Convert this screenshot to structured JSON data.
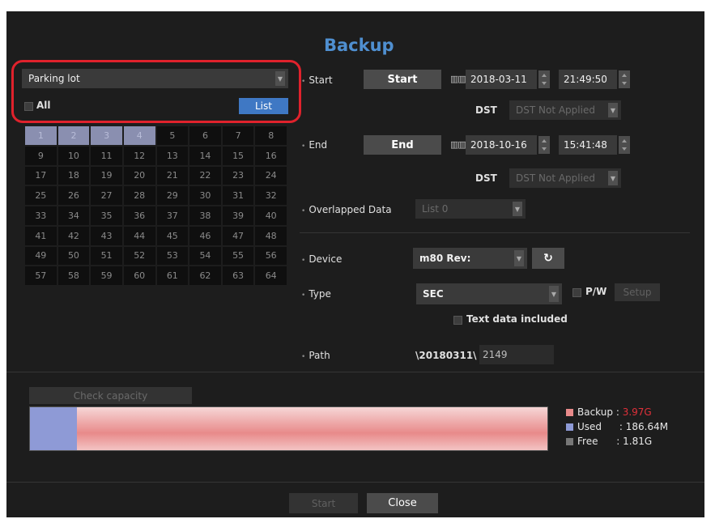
{
  "dialog": {
    "title": "Backup"
  },
  "camera": {
    "selected": "Parking lot",
    "all_label": "All",
    "list_label": "List",
    "channels": [
      "1",
      "2",
      "3",
      "4",
      "5",
      "6",
      "7",
      "8",
      "9",
      "10",
      "11",
      "12",
      "13",
      "14",
      "15",
      "16",
      "17",
      "18",
      "19",
      "20",
      "21",
      "22",
      "23",
      "24",
      "25",
      "26",
      "27",
      "28",
      "29",
      "30",
      "31",
      "32",
      "33",
      "34",
      "35",
      "36",
      "37",
      "38",
      "39",
      "40",
      "41",
      "42",
      "43",
      "44",
      "45",
      "46",
      "47",
      "48",
      "49",
      "50",
      "51",
      "52",
      "53",
      "54",
      "55",
      "56",
      "57",
      "58",
      "59",
      "60",
      "61",
      "62",
      "63",
      "64"
    ],
    "selected_channels": [
      "1",
      "2",
      "3",
      "4"
    ]
  },
  "start": {
    "label": "Start",
    "button": "Start",
    "date": "2018-03-11",
    "time": "21:49:50",
    "dst_label": "DST",
    "dst_value": "DST Not Applied"
  },
  "end": {
    "label": "End",
    "button": "End",
    "date": "2018-10-16",
    "time": "15:41:48",
    "dst_label": "DST",
    "dst_value": "DST Not Applied"
  },
  "overlap": {
    "label": "Overlapped Data",
    "value": "List 0"
  },
  "device": {
    "label": "Device",
    "value": "m80 Rev:"
  },
  "type": {
    "label": "Type",
    "value": "SEC",
    "pw_label": "P/W",
    "setup_label": "Setup",
    "text_data_label": "Text data included"
  },
  "path": {
    "label": "Path",
    "prefix": "\\20180311\\",
    "value": "2149"
  },
  "capacity": {
    "check_label": "Check capacity",
    "backup_label": "Backup",
    "backup_value": "3.97G",
    "used_label": "Used",
    "used_value": "186.64M",
    "free_label": "Free",
    "free_value": "1.81G",
    "used_fraction": 0.09,
    "backup_fraction": 0.91,
    "colors": {
      "backup": "#e88a8a",
      "used": "#8e9ad6",
      "free": "#777777",
      "backup_value": "#e0303a"
    }
  },
  "footer": {
    "start_label": "Start",
    "close_label": "Close"
  }
}
